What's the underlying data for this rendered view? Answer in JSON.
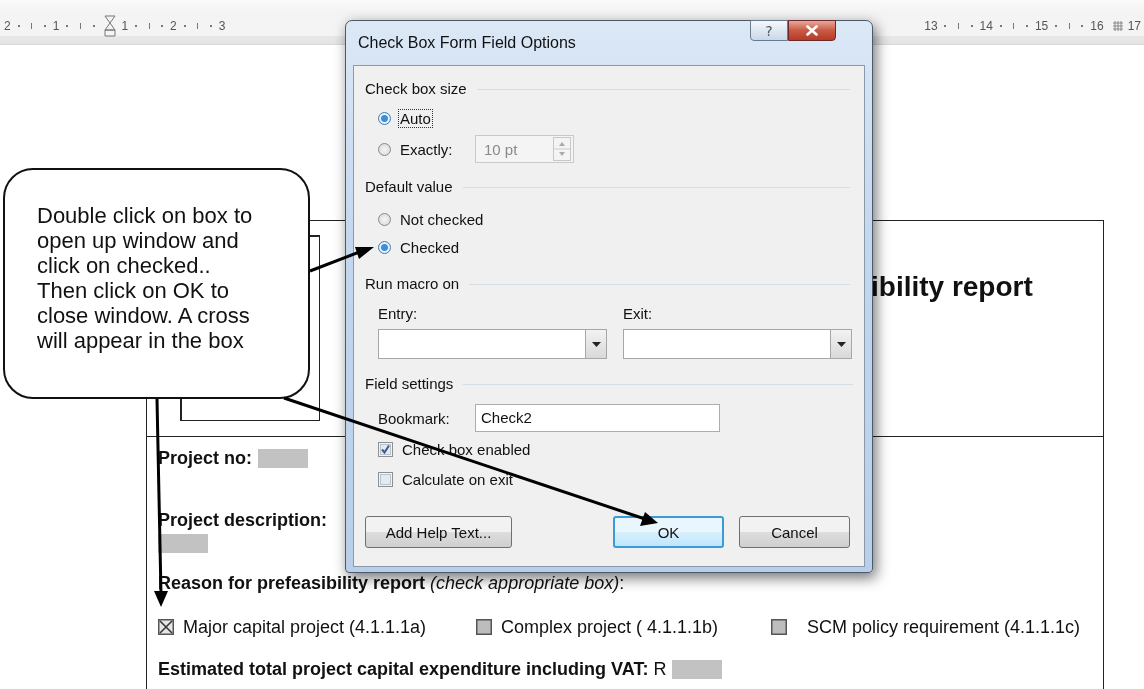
{
  "ruler": {
    "left_numbers": [
      "2",
      "1",
      "1",
      "2",
      "3"
    ],
    "right_numbers": [
      "13",
      "14",
      "15",
      "16",
      "17"
    ]
  },
  "document": {
    "title": "ibility report",
    "project_no_label": "Project no:",
    "project_description_label": "Project description:",
    "reason": "**Reason for prefeasibility report** *(check appropriate box)*:",
    "options": [
      {
        "label": "Major capital project (4.1.1.1a)",
        "checked": true
      },
      {
        "label": "Complex project ( 4.1.1.1b)",
        "checked": false
      },
      {
        "label": "SCM policy requirement (4.1.1.1c)",
        "checked": false
      }
    ],
    "capex": "**Estimated total project capital expenditure including VAT:** R"
  },
  "dialog": {
    "title": "Check Box Form Field Options",
    "help_button": "?",
    "size": {
      "heading": "Check box size",
      "options": [
        {
          "label": "Auto",
          "selected": true
        },
        {
          "label": "Exactly:",
          "selected": false
        }
      ],
      "exactly_field": {
        "value": "10 pt",
        "disabled": true
      }
    },
    "default_value": {
      "heading": "Default value",
      "options": [
        {
          "label": "Not checked",
          "selected": false
        },
        {
          "label": "Checked",
          "selected": true
        }
      ]
    },
    "run_macro": {
      "heading": "Run macro on",
      "entry_label": "Entry:",
      "exit_label": "Exit:"
    },
    "field_settings": {
      "heading": "Field settings",
      "bookmark_label": "Bookmark:",
      "bookmark_value": "Check2",
      "checkboxes": [
        {
          "label": "Check box enabled",
          "checked": true
        },
        {
          "label": "Calculate on exit",
          "checked": false
        }
      ]
    },
    "buttons": [
      {
        "label": "Add Help Text...",
        "default": false
      },
      {
        "label": "OK",
        "default": true
      },
      {
        "label": "Cancel",
        "default": false
      }
    ]
  },
  "callout": {
    "text": "Double click on box to open up window and click on checked.. Then click on OK to close window. A cross will appear in the box"
  }
}
